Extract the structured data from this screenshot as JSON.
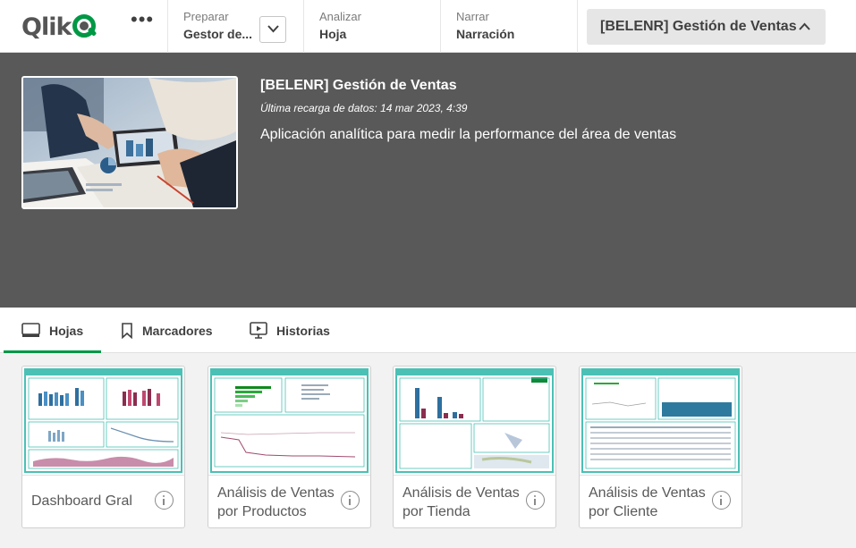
{
  "topbar": {
    "logo_text": "Qlik",
    "logo_registered": "®",
    "more_label": "•••",
    "prepare": {
      "label": "Preparar",
      "value": "Gestor de..."
    },
    "analyze": {
      "label": "Analizar",
      "value": "Hoja"
    },
    "narrate": {
      "label": "Narrar",
      "value": "Narración"
    },
    "app_name": "[BELENR] Gestión de Ventas"
  },
  "hero": {
    "title": "[BELENR] Gestión de Ventas",
    "last_reload": "Última recarga de datos: 14 mar 2023, 4:39",
    "description": "Aplicación analítica para medir la performance del área de ventas"
  },
  "tabs": [
    {
      "label": "Hojas",
      "icon": "sheet-icon",
      "active": true
    },
    {
      "label": "Marcadores",
      "icon": "bookmark-icon",
      "active": false
    },
    {
      "label": "Historias",
      "icon": "story-icon",
      "active": false
    }
  ],
  "sheets": [
    {
      "title": "Dashboard Gral"
    },
    {
      "title": "Análisis de Ventas por Productos"
    },
    {
      "title": "Análisis de Ventas por Tienda"
    },
    {
      "title": "Análisis de Ventas por Cliente"
    }
  ],
  "colors": {
    "accent": "#009845",
    "hero_bg": "#595959",
    "sheet_border": "#4bc0b5"
  }
}
